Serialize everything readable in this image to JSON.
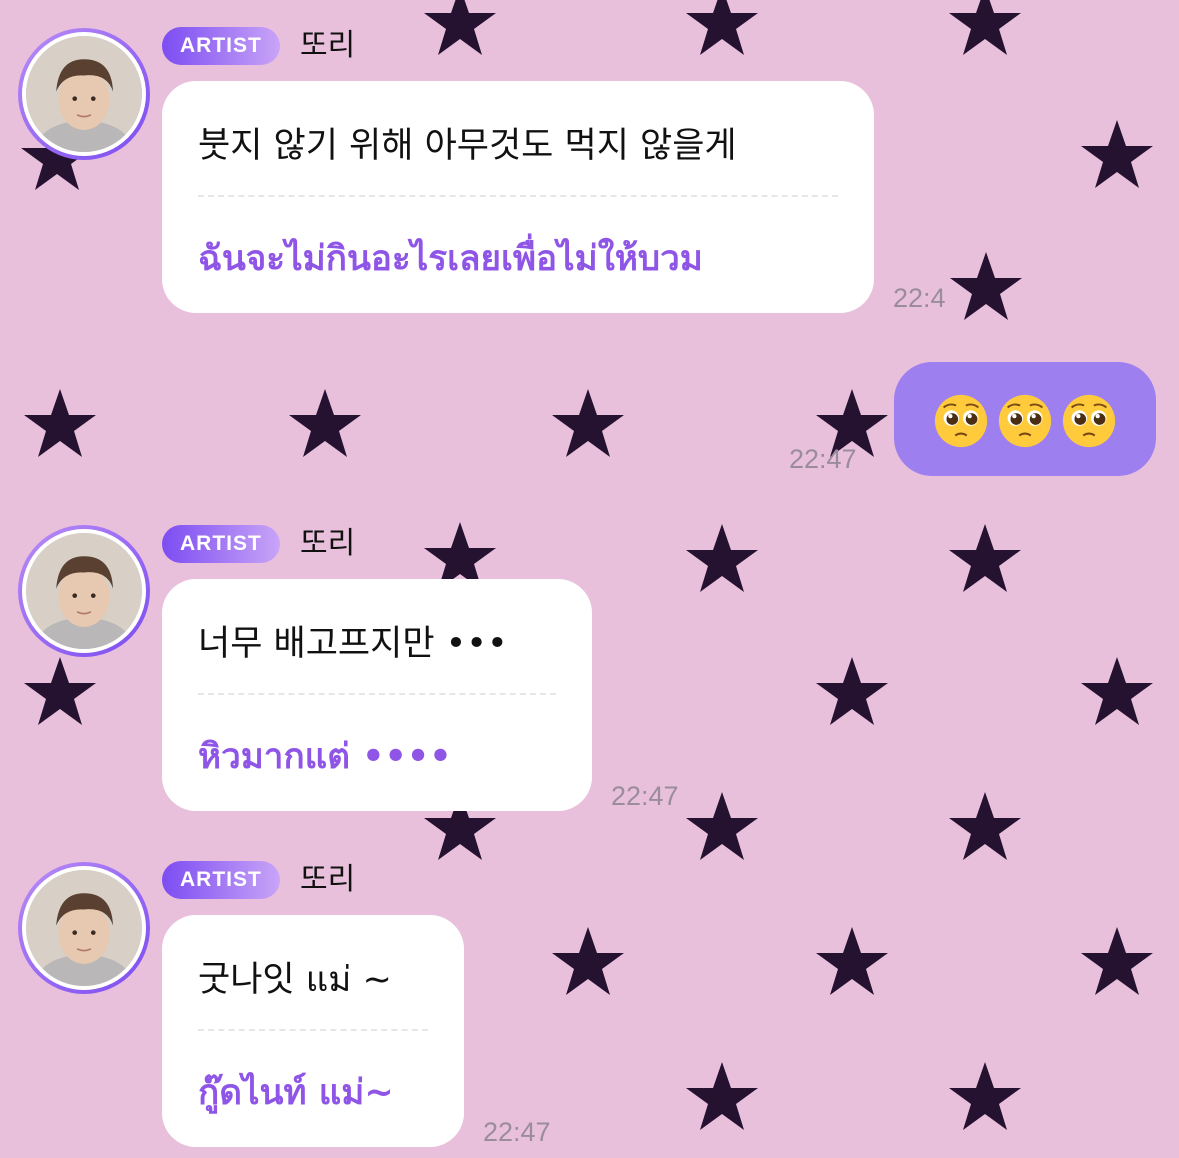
{
  "messages": [
    {
      "sender_badge": "ARTIST",
      "sender_name": "또리",
      "original": "붓지 않기 위해 아무것도 먹지 않을게",
      "translation": "ฉันจะไม่กินอะไรเลยเพื่อไม่ให้บวม",
      "time": "22:4"
    },
    {
      "sender_badge": "ARTIST",
      "sender_name": "또리",
      "original": "너무 배고프지만 •••",
      "translation": "หิวมากแต่ ••••",
      "time": "22:47"
    },
    {
      "sender_badge": "ARTIST",
      "sender_name": "또리",
      "original": "굿나잇 แม่ ~",
      "translation": "กู๊ดไนท์ แม่~",
      "time": "22:47"
    }
  ],
  "my_message": {
    "emojis": [
      "pleading-face",
      "pleading-face",
      "pleading-face"
    ],
    "time": "22:47"
  },
  "colors": {
    "background": "#e9c0dc",
    "star": "#241230",
    "translation_text": "#8f55e6",
    "my_bubble": "#9d7ff0",
    "badge_start": "#7c4df2",
    "badge_end": "#c9a4f7"
  }
}
